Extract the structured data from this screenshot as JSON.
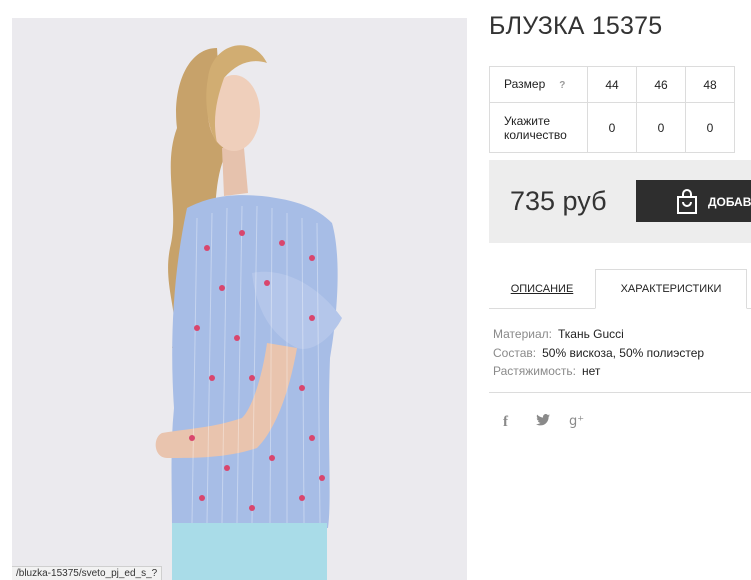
{
  "product": {
    "title": "БЛУЗКА 15375"
  },
  "size_table": {
    "size_label": "Размер",
    "help_glyph": "?",
    "sizes": [
      "44",
      "46",
      "48"
    ],
    "qty_label_line1": "Укажите",
    "qty_label_line2": "количество",
    "quantities": [
      "0",
      "0",
      "0"
    ]
  },
  "purchase": {
    "price": "735 руб",
    "add_button_label": "ДОБАВИ",
    "bag_icon": "shopping-bag-icon"
  },
  "tabs": {
    "description": "ОПИСАНИЕ",
    "characteristics": "ХАРАКТЕРИСТИКИ"
  },
  "specs": [
    {
      "key": "Материал:",
      "value": "Ткань Gucci"
    },
    {
      "key": "Состав:",
      "value": "50% вискоза, 50% полиэстер"
    },
    {
      "key": "Растяжимость:",
      "value": "нет"
    }
  ],
  "social": {
    "facebook": "f",
    "twitter": "🐦",
    "googleplus": "g⁺"
  },
  "status_bar": {
    "url": "/bluzka-15375/sveto_pj_ed_s_?"
  },
  "colors": {
    "button_bg": "#2e2e2e",
    "price_bar_bg": "#ededed",
    "photo_bg": "#ebeaee"
  }
}
